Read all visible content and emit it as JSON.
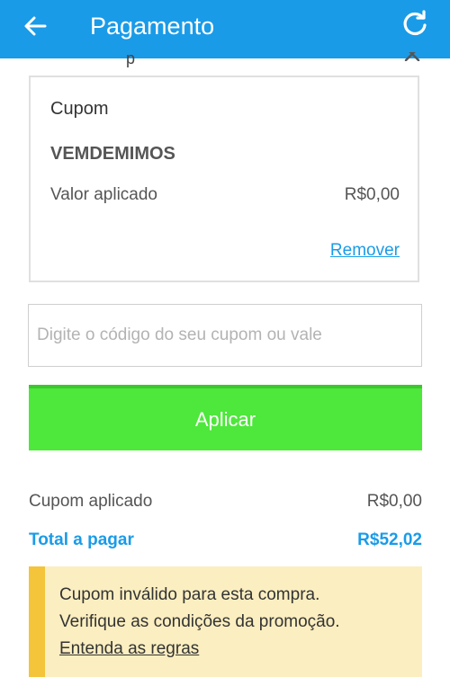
{
  "appbar": {
    "title": "Pagamento",
    "back_icon": "arrow-left-icon",
    "refresh_icon": "refresh-icon"
  },
  "peek": {
    "text": "p"
  },
  "coupon_card": {
    "label": "Cupom",
    "code": "VEMDEMIMOS",
    "applied_label": "Valor aplicado",
    "applied_value": "R$0,00",
    "remove_label": "Remover"
  },
  "coupon_input": {
    "placeholder": "Digite o código do seu cupom ou vale",
    "value": ""
  },
  "apply_button": {
    "label": "Aplicar"
  },
  "summary": {
    "coupon_label": "Cupom aplicado",
    "coupon_value": "R$0,00",
    "total_label": "Total a pagar",
    "total_value": "R$52,02"
  },
  "alert": {
    "line1": "Cupom inválido para esta compra.",
    "line2": "Verifique as condições da promoção.",
    "link": "Entenda as regras"
  },
  "colors": {
    "primary": "#1a9be8",
    "apply_button": "#4ee73b",
    "alert_background": "#fbeec0",
    "alert_accent": "#f4c43a"
  }
}
